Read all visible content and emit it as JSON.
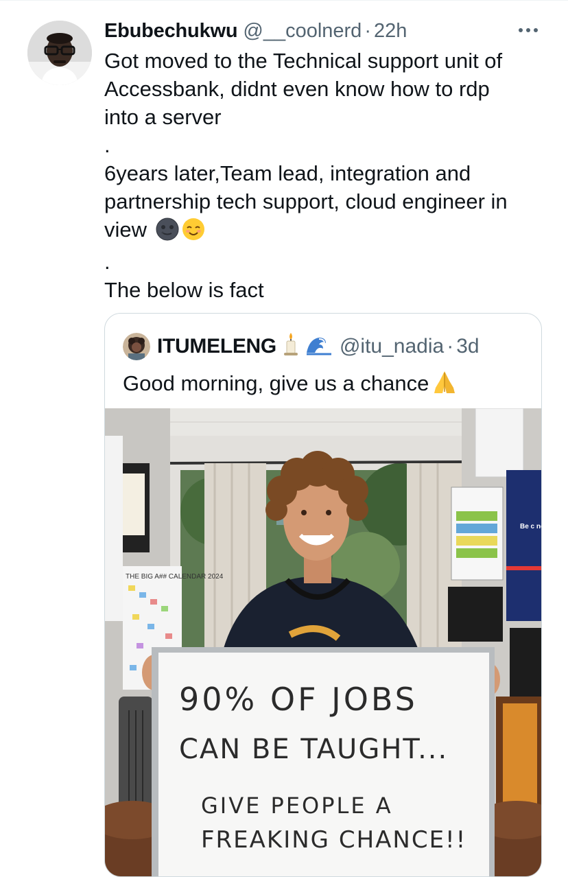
{
  "tweet": {
    "display_name": "Ebubechukwu",
    "handle": "@__coolnerd",
    "separator": "·",
    "time": "22h",
    "more_icon": "more-horizontal-icon",
    "text_lines": {
      "l1": "Got moved to the Technical support unit of",
      "l2": "Accessbank, didnt even know how to rdp",
      "l3": "into a server",
      "l4": ".",
      "l5": "6years later,Team lead, integration and",
      "l6": "partnership tech support, cloud engineer in",
      "l7": "view",
      "l8": ".",
      "l9": "The below is fact"
    },
    "emoji_1": "new-moon-face-emoji",
    "emoji_2": "smiling-face-emoji"
  },
  "quoted_tweet": {
    "display_name": "ITUMELENG",
    "emoji_candle": "candle-emoji",
    "emoji_wave": "wave-emoji",
    "handle": "@itu_nadia",
    "separator": "·",
    "time": "3d",
    "text": "Good morning, give us a chance",
    "emoji_pray": "folded-hands-emoji",
    "photo": {
      "whiteboard_lines": {
        "w1": "90% OF JOBS",
        "w2": "CAN BE TAUGHT...",
        "w3": "GIVE PEOPLE A",
        "w4": "FREAKING CHANCE!!"
      },
      "calendar_label": "THE BIG A## CALENDAR 2024",
      "poster_text": "Be c not ju"
    }
  },
  "colors": {
    "text": "#0f1419",
    "secondary": "#536471",
    "border": "#cfd9de"
  }
}
